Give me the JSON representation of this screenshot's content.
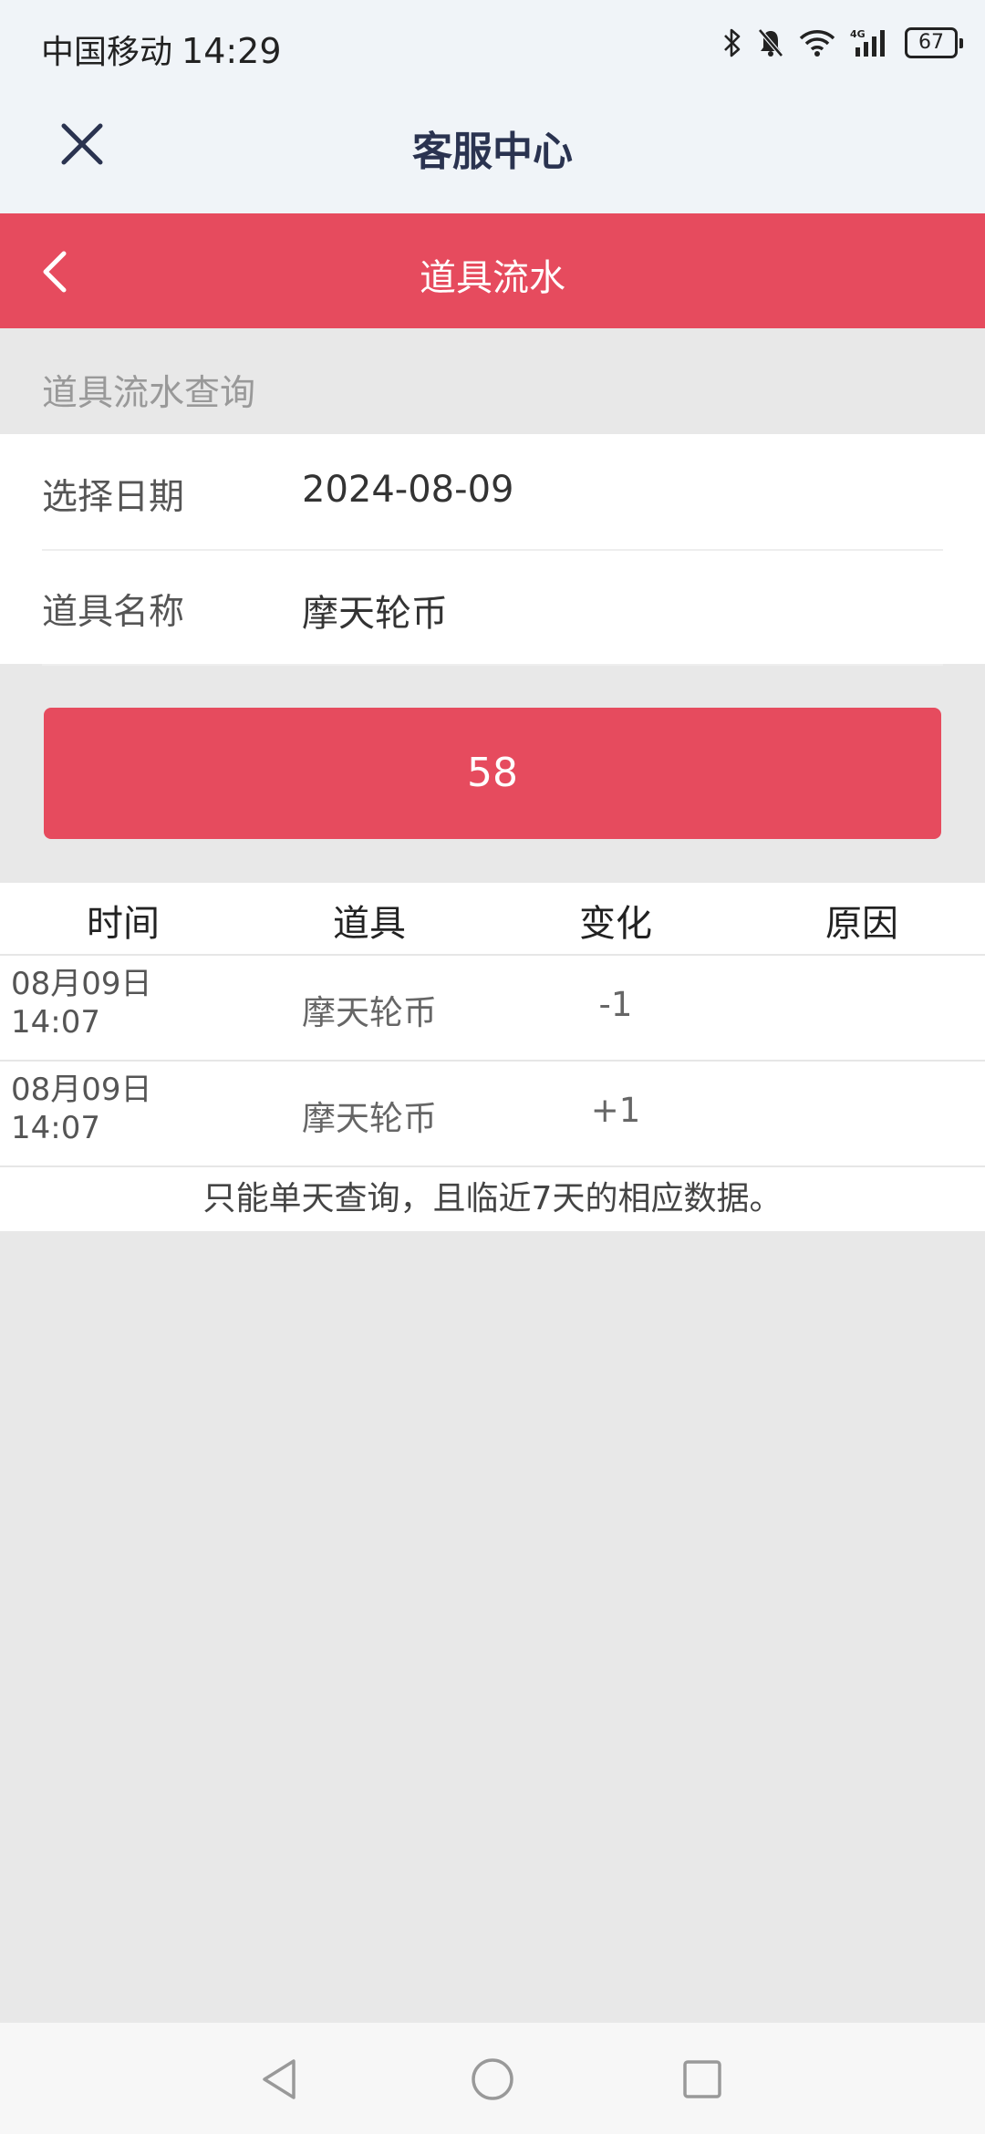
{
  "status_bar": {
    "carrier": "中国移动",
    "time": "14:29",
    "network": "4G",
    "battery": "67",
    "icons": [
      "bluetooth-icon",
      "mute-icon",
      "wifi-icon",
      "signal-icon",
      "battery-icon"
    ]
  },
  "header": {
    "title": "客服中心",
    "close_icon": "close-icon"
  },
  "subheader": {
    "title": "道具流水",
    "back_icon": "chevron-left-icon"
  },
  "section": {
    "label": "道具流水查询"
  },
  "form": {
    "date_label": "选择日期",
    "date_value": "2024-08-09",
    "item_label": "道具名称",
    "item_value": "摩天轮币"
  },
  "query_button": {
    "label": "58"
  },
  "table": {
    "headers": [
      "时间",
      "道具",
      "变化",
      "原因"
    ],
    "rows": [
      {
        "date": "08月09日",
        "time": "14:07",
        "item": "摩天轮币",
        "change": "-1",
        "reason": ""
      },
      {
        "date": "08月09日",
        "time": "14:07",
        "item": "摩天轮币",
        "change": "+1",
        "reason": ""
      }
    ],
    "note": "只能单天查询，且临近7天的相应数据。"
  },
  "colors": {
    "accent": "#e64b5e",
    "header_bg": "#f0f4f8",
    "page_bg": "#e8e8e8",
    "title_text": "#2a3350"
  },
  "nav_bar": {
    "icons": [
      "back-triangle-icon",
      "home-circle-icon",
      "recent-square-icon"
    ]
  }
}
